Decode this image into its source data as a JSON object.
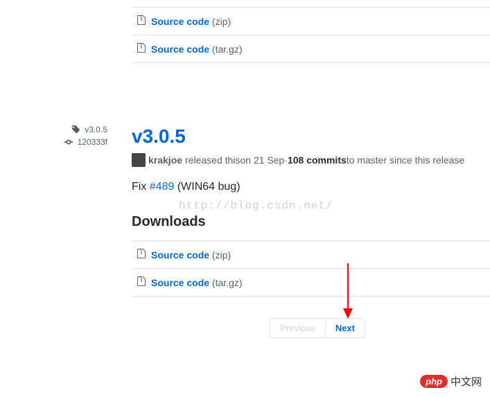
{
  "top_downloads": [
    {
      "label": "Source code",
      "ext": "(zip)"
    },
    {
      "label": "Source code",
      "ext": "(tar.gz)"
    }
  ],
  "sidebar": {
    "tag": "v3.0.5",
    "commit": "120333f"
  },
  "release": {
    "title": "v3.0.5",
    "author": "krakjoe",
    "meta_released": " released this ",
    "meta_date": "on 21 Sep",
    "meta_sep": " · ",
    "commits_count": "108 commits",
    "meta_tail": " to master since this release",
    "body_prefix": "Fix ",
    "body_issue": "#489",
    "body_suffix": " (WIN64 bug)"
  },
  "downloads_heading": "Downloads",
  "downloads": [
    {
      "label": "Source code",
      "ext": "(zip)"
    },
    {
      "label": "Source code",
      "ext": "(tar.gz)"
    }
  ],
  "pagination": {
    "prev": "Previous",
    "next": "Next"
  },
  "watermark": "http://blog.csdn.net/",
  "footer": {
    "pill": "php",
    "text": "中文网"
  }
}
